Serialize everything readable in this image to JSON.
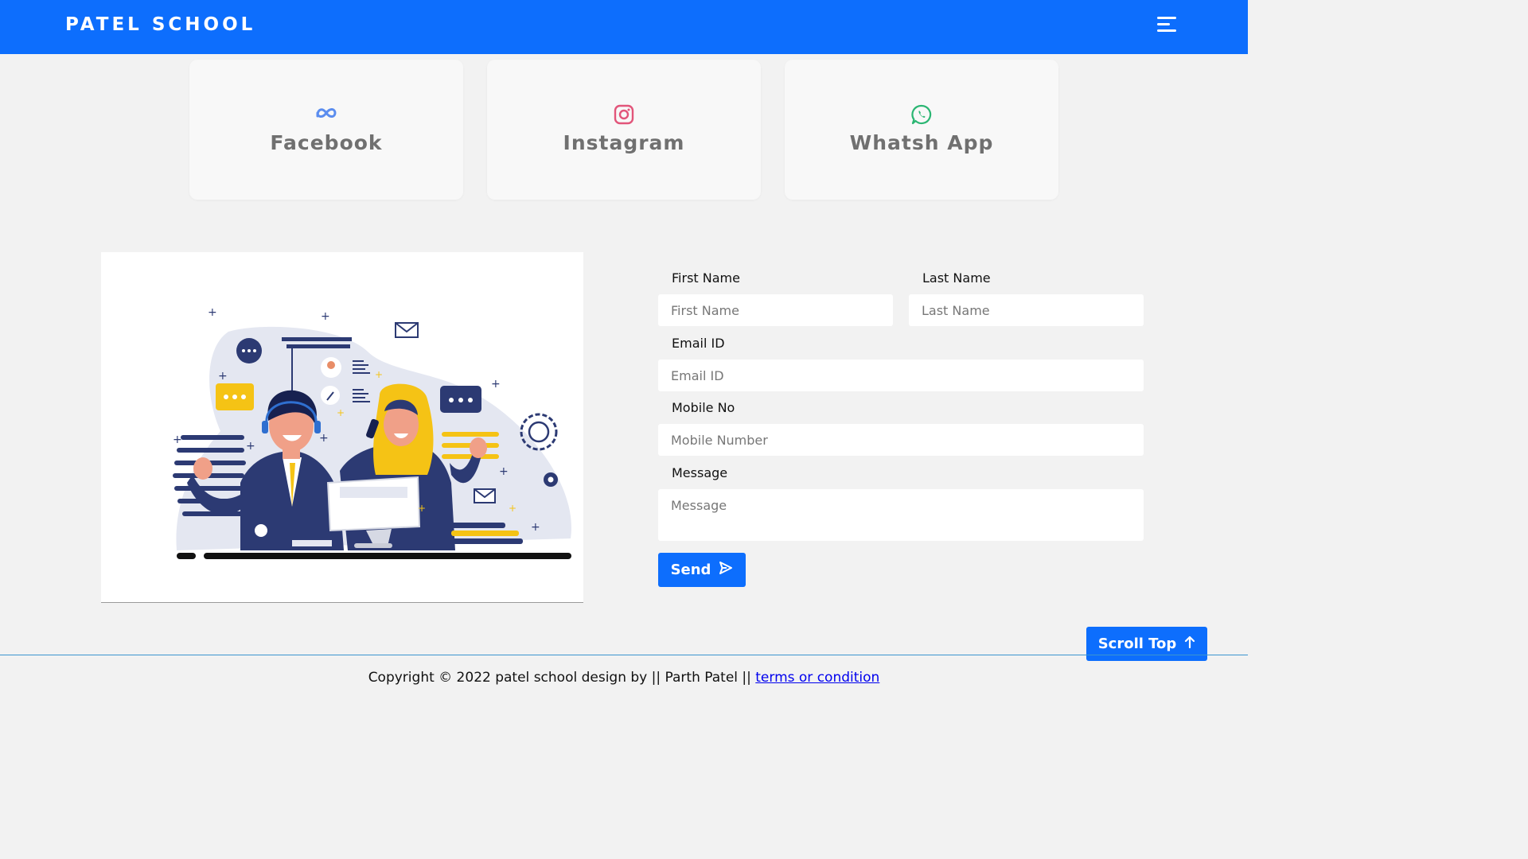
{
  "navbar": {
    "brand": "PATEL SCHOOL",
    "menu_icon": "menu-icon",
    "color": "#0d6efd"
  },
  "social": [
    {
      "label": "Facebook",
      "icon": "meta-icon",
      "icon_color": "#5b8def"
    },
    {
      "label": "Instagram",
      "icon": "instagram-icon",
      "icon_color": "#e2557a"
    },
    {
      "label": "Whatsh App",
      "icon": "whatsapp-icon",
      "icon_color": "#2bb673"
    }
  ],
  "form": {
    "first_name_label": "First Name",
    "first_name_placeholder": "First Name",
    "last_name_label": "Last Name",
    "last_name_placeholder": "Last Name",
    "email_label": "Email ID",
    "email_placeholder": "Email ID",
    "mobile_label": "Mobile No",
    "mobile_placeholder": "Mobile Number",
    "message_label": "Message",
    "message_placeholder": "Message",
    "send_label": "Send",
    "send_icon": "send-icon"
  },
  "scroll_top": {
    "label": "Scroll Top",
    "icon": "arrow-up-icon"
  },
  "footer": {
    "copyright": "Copyright © 2022 patel school design by || Parth Patel ||",
    "terms_link": "terms or condition"
  }
}
